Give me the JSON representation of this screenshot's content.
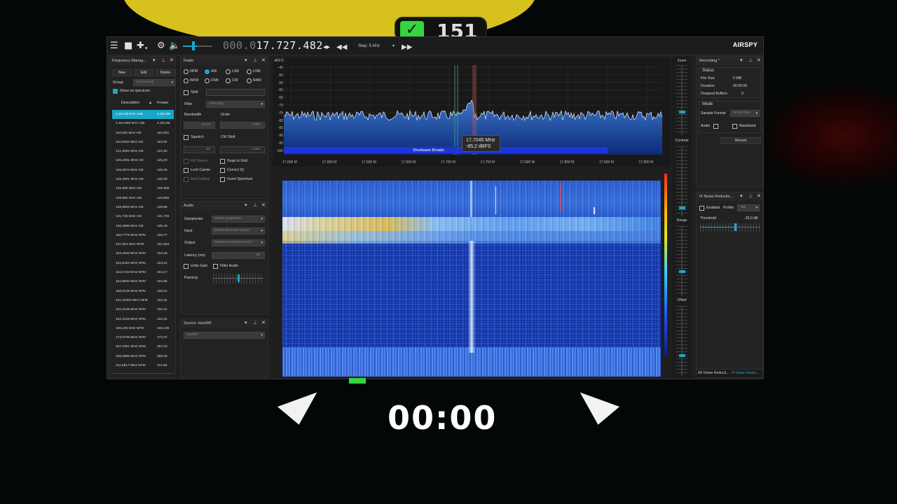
{
  "overlay": {
    "badge_value": "151",
    "timer": "00:00",
    "check_icon": "check-icon"
  },
  "toolbar": {
    "freq_dim": "000.0",
    "freq_bright": "17.727.482",
    "step_label": "Step: 5 kHz",
    "logo": "AIRSPY",
    "icons": [
      "menu-icon",
      "stop-icon",
      "add-icon",
      "gear-icon",
      "speaker-icon",
      "swap-icon",
      "rewind-icon",
      "fast-forward-icon"
    ]
  },
  "freq_manager": {
    "title": "Frequency Manag...",
    "new": "New",
    "edit": "Edit",
    "delete": "Delete",
    "group_label": "Group:",
    "group_value": "[All Groups]",
    "show_on_spectrum": "Show on spectrum",
    "col_description": "Description",
    "col_freq": "Freque",
    "rows": [
      {
        "d": "4,322.88 kHz LSB",
        "f": "4,322.88"
      },
      {
        "d": "4,322,969 kHz LSB",
        "f": "4,322,96"
      },
      {
        "d": "119,000 MHz AM",
        "f": "119,000"
      },
      {
        "d": "119,0002 MHz AM",
        "f": "119,00"
      },
      {
        "d": "121,9002 MHz AM",
        "f": "121,90"
      },
      {
        "d": "125,2001 MHz AM",
        "f": "125,20"
      },
      {
        "d": "125,2974 MHz AM",
        "f": "125,29"
      },
      {
        "d": "125,3001 MHz AM",
        "f": "125,30"
      },
      {
        "d": "125,900 MHz AM",
        "f": "125,900"
      },
      {
        "d": "128,850 MHz AM",
        "f": "128,850"
      },
      {
        "d": "128,8503 MHz AM",
        "f": "128,85"
      },
      {
        "d": "131,725 MHz AM",
        "f": "131,725"
      },
      {
        "d": "135,4999 MHz AM",
        "f": "135,49"
      },
      {
        "d": "150,7778 MHz NFM",
        "f": "150,77"
      },
      {
        "d": "151,654 MHz NFM",
        "f": "151,654"
      },
      {
        "d": "153,2943 MHz NFM",
        "f": "153,29"
      },
      {
        "d": "153,5152 MHz NFM",
        "f": "153,51"
      },
      {
        "d": "154,1743 MHz NFM",
        "f": "154,17"
      },
      {
        "d": "154,9593 MHz NFM",
        "f": "154,95"
      },
      {
        "d": "158,0125 MHz NFM",
        "f": "158,01"
      },
      {
        "d": "161,19400 MHz NFM",
        "f": "162,31"
      },
      {
        "d": "162,3126 MHz NFM",
        "f": "162,31"
      },
      {
        "d": "162,3128 MHz NFM",
        "f": "162,31"
      },
      {
        "d": "166,196 MHz NFM",
        "f": "166,196"
      },
      {
        "d": "173,0749 MHz NFM",
        "f": "173,07"
      },
      {
        "d": "257,0391 MHz NFM",
        "f": "257,03"
      },
      {
        "d": "265,0995 MHz NFM",
        "f": "265,09"
      },
      {
        "d": "411,5817 MHz NFM",
        "f": "411,58"
      }
    ]
  },
  "radio": {
    "title": "Radio",
    "modes_row1": [
      "NFM",
      "AM",
      "LSB",
      "USB"
    ],
    "modes_row2": [
      "WFM",
      "DSB",
      "CW",
      "RAW"
    ],
    "selected_mode": "AM",
    "shift": "Shift",
    "filter": "Filter",
    "filter_value": "Hamming",
    "bandwidth": "Bandwidth",
    "order": "Order",
    "bandwidth_value": "6,070",
    "order_value": "1.000",
    "squelch": "Squelch",
    "cw_shift": "CW Shift",
    "squelch_value": "-50",
    "cw_value": "1.000",
    "fm_stereo": "FM Stereo",
    "snap_to_grid": "Snap to Grid",
    "lock_carrier": "Lock Carrier",
    "correct_iq": "Correct IQ",
    "anti_fading": "Anti-Fading",
    "invert_spectrum": "Invert Spectrum"
  },
  "audio": {
    "title": "Audio",
    "samplerate": "Samplerate",
    "samplerate_value": "48000 sample/sec",
    "input": "Input",
    "input_value": "[MME] Microsoft Sound",
    "output": "Output",
    "output_value": "[Windows DirectSound] S",
    "latency": "Latency (ms)",
    "latency_value": "50",
    "unity_gain": "Unity Gain",
    "filter_audio": "Filter Audio",
    "panning": "Panning"
  },
  "source": {
    "title": "Source: HackRF",
    "value": "HackRF"
  },
  "spectrum": {
    "unit": "dBFS",
    "y_ticks": [
      "-45",
      "-50",
      "-55",
      "-60",
      "-65",
      "-70",
      "-75",
      "-80",
      "-85",
      "-90",
      "-95",
      "-100"
    ],
    "x_ticks": [
      "17,600 M",
      "17,650 M",
      "17,600 M",
      "17,650 M",
      "17,700 M",
      "17,750 M",
      "17,800 M",
      "17,850 M",
      "17,900 M",
      "17,950 M"
    ],
    "band_label": "Shortwave Broadc",
    "tooltip_freq": "17,7045 MHz",
    "tooltip_level": "-85,2 dBFS"
  },
  "right_strip": {
    "zoom": "Zoom",
    "contrast": "Contrast",
    "range": "Range",
    "offset": "Offset"
  },
  "recording": {
    "title": "Recording *",
    "status": "Status",
    "file_size": "File Size",
    "file_size_value": "0 MB",
    "duration": "Duration",
    "duration_value": "00:00:00",
    "dropped": "Dropped Buffers",
    "dropped_value": "0",
    "mode": "Mode",
    "sample_format": "Sample Format",
    "sample_format_value": "16 Bit PCM",
    "audio": "Audio",
    "baseband": "Baseband",
    "record": "Record"
  },
  "if_noise": {
    "title": "IF Noise Reductio...",
    "enabled": "Enabled",
    "profile": "Profile:",
    "profile_value": "Talk",
    "threshold": "Threshold",
    "threshold_value": "-35,0 dB",
    "tab_af": "AF Noise Reducti...",
    "tab_if": "IF Noise Reduc..."
  }
}
